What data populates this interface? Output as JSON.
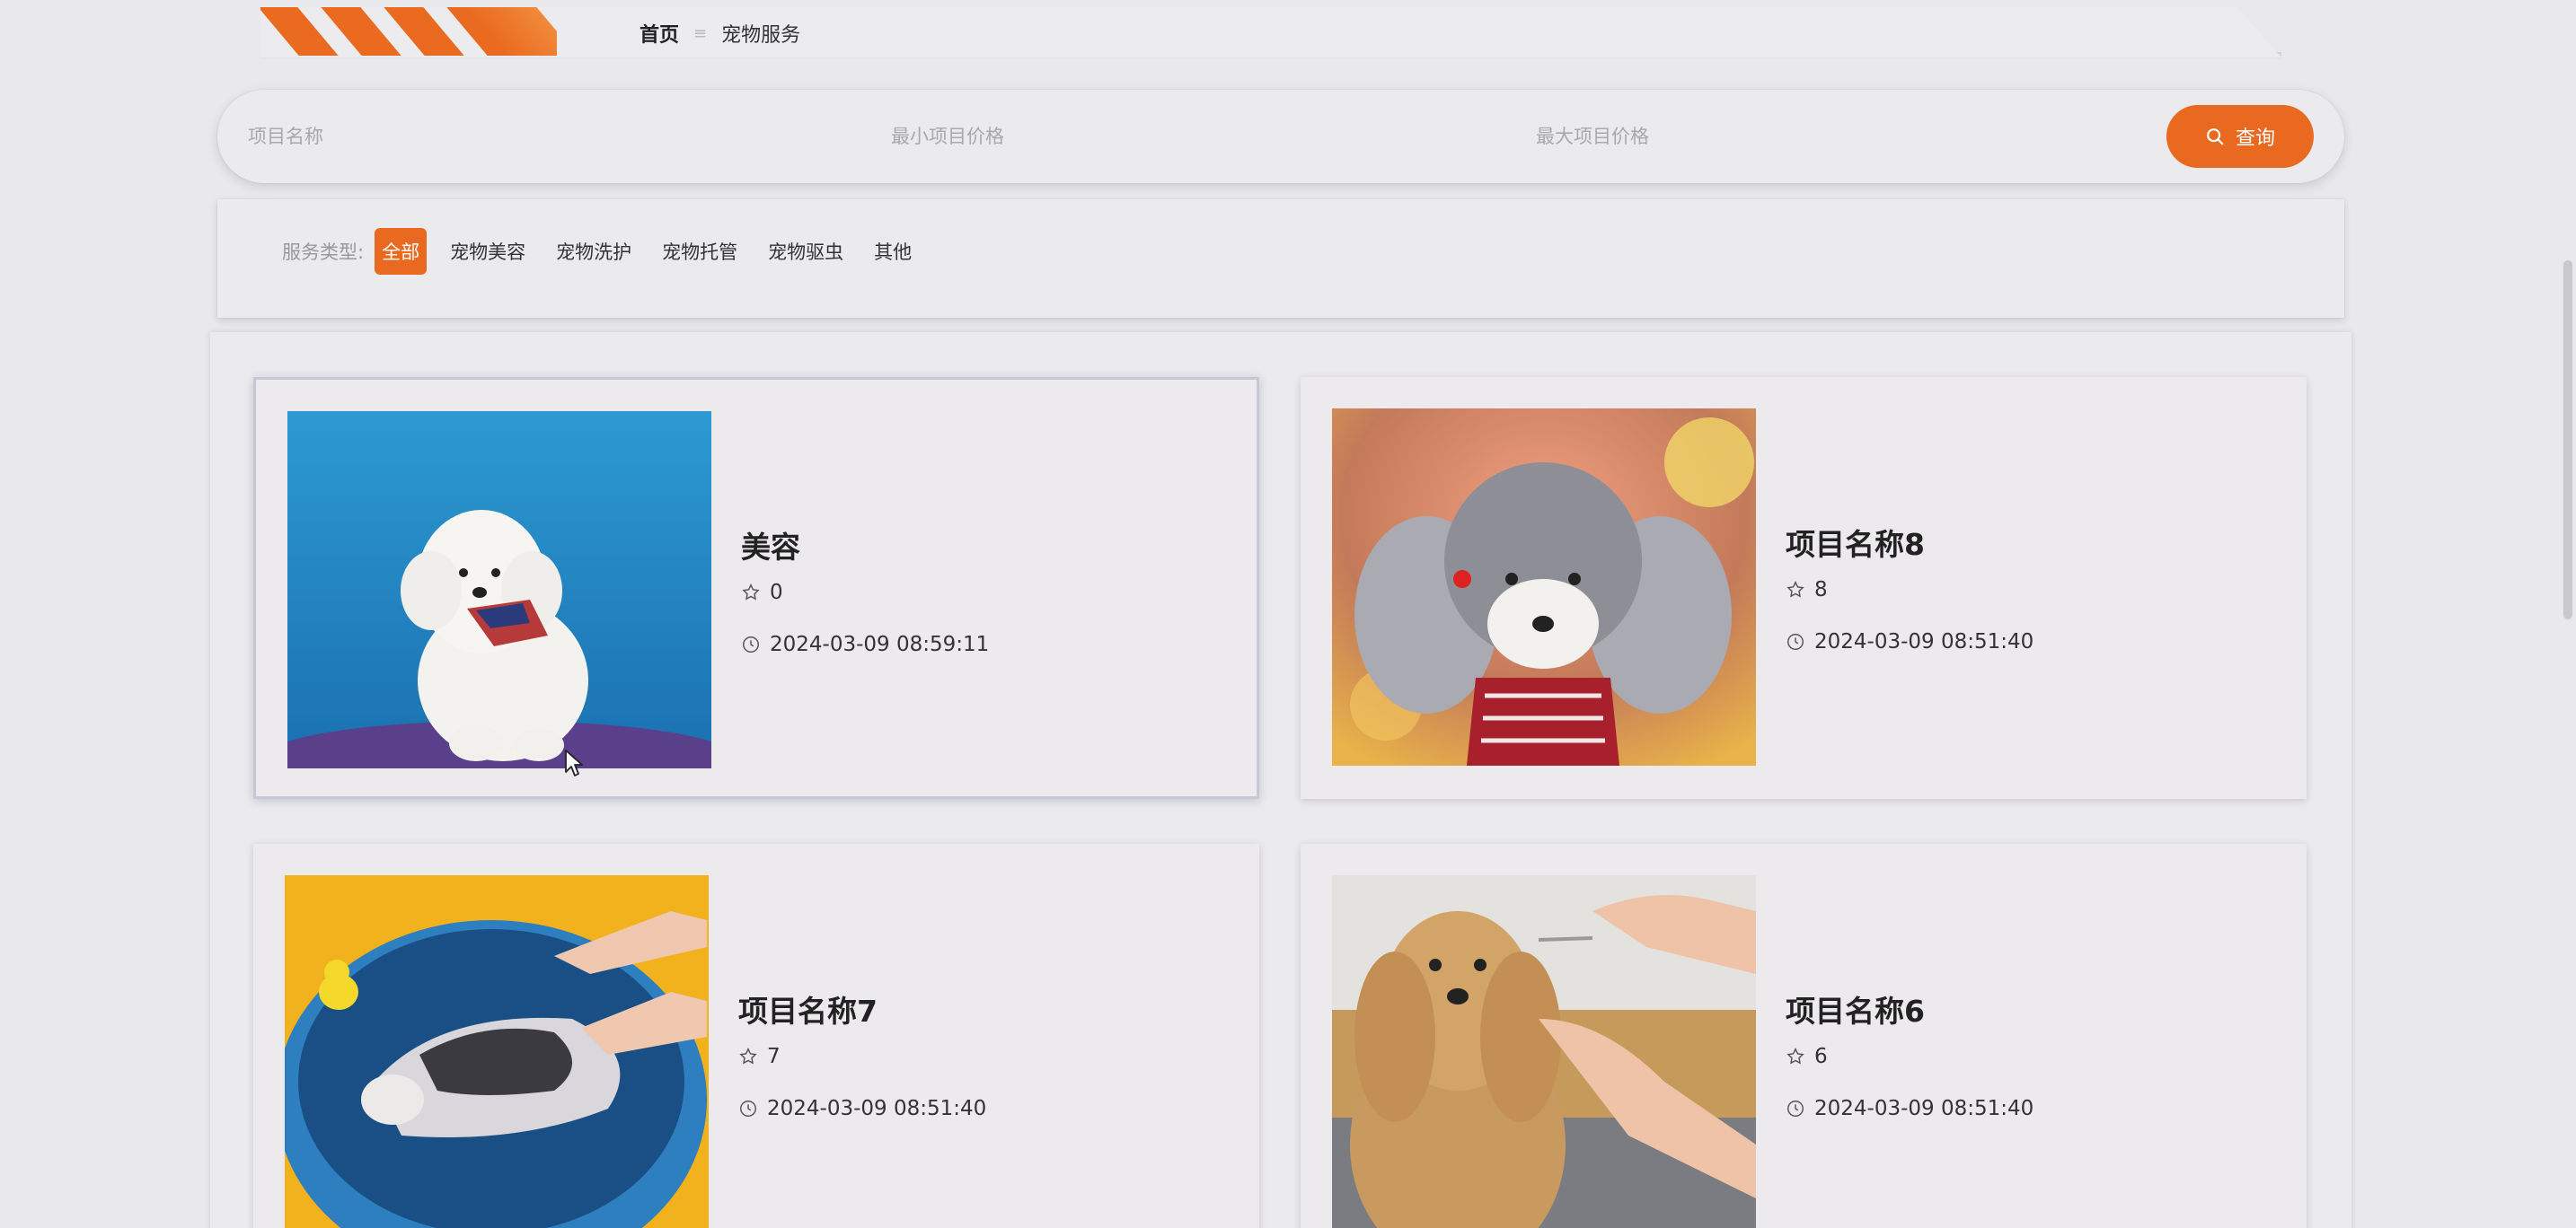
{
  "breadcrumb": {
    "home": "首页",
    "separator": "≡",
    "current": "宠物服务"
  },
  "search": {
    "name_placeholder": "项目名称",
    "min_price_placeholder": "最小项目价格",
    "max_price_placeholder": "最大项目价格",
    "button_label": "查询",
    "button_icon": "search-icon"
  },
  "filter": {
    "label": "服务类型:",
    "options": [
      "全部",
      "宠物美容",
      "宠物洗护",
      "宠物托管",
      "宠物驱虫",
      "其他"
    ],
    "selected": "全部"
  },
  "cards": [
    {
      "title": "美容",
      "likes": "0",
      "time": "2024-03-09 08:59:11",
      "image": "white-poodle-photo"
    },
    {
      "title": "项目名称8",
      "likes": "8",
      "time": "2024-03-09 08:51:40",
      "image": "grey-poodle-photo"
    },
    {
      "title": "项目名称7",
      "likes": "7",
      "time": "2024-03-09 08:51:40",
      "image": "dog-bath-pool-photo"
    },
    {
      "title": "项目名称6",
      "likes": "6",
      "time": "2024-03-09 08:51:40",
      "image": "dog-grooming-photo"
    }
  ],
  "colors": {
    "accent": "#e8691f",
    "background": "#e9e8eb"
  }
}
